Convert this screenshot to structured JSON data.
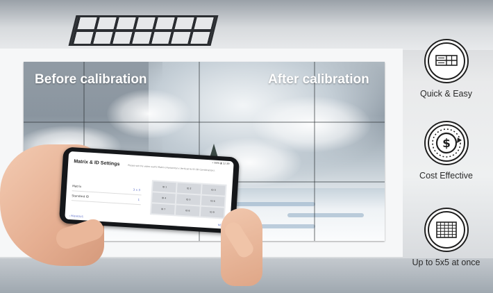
{
  "videowall": {
    "before_label": "Before calibration",
    "after_label": "After calibration"
  },
  "phone": {
    "status": "⌁ 64% ▮ 12:39",
    "title": "Matrix & ID Settings",
    "hint": "Please set the video wall's Matrix (Horizontal x Vertical) & ID (ID Combination).",
    "rows": [
      {
        "label": "Matrix",
        "value": "3 x 3"
      },
      {
        "label": "Standard ID",
        "value": "1"
      }
    ],
    "grid": [
      "ID 1",
      "ID 2",
      "ID 3",
      "ID 4",
      "ID 5",
      "ID 6",
      "ID 7",
      "ID 8",
      "ID 9"
    ],
    "prev_label": "‹ PREVIOUS",
    "next_label": "NEXT"
  },
  "features": [
    {
      "label": "Quick & Easy",
      "icon": "videowall-grid-icon"
    },
    {
      "label": "Cost Effective",
      "icon": "dollar-cycle-icon"
    },
    {
      "label": "Up to 5x5 at once",
      "icon": "five-by-five-grid-icon"
    }
  ],
  "colors": {
    "accent": "#5a6cc8",
    "icon_stroke": "#1f1f1f"
  }
}
